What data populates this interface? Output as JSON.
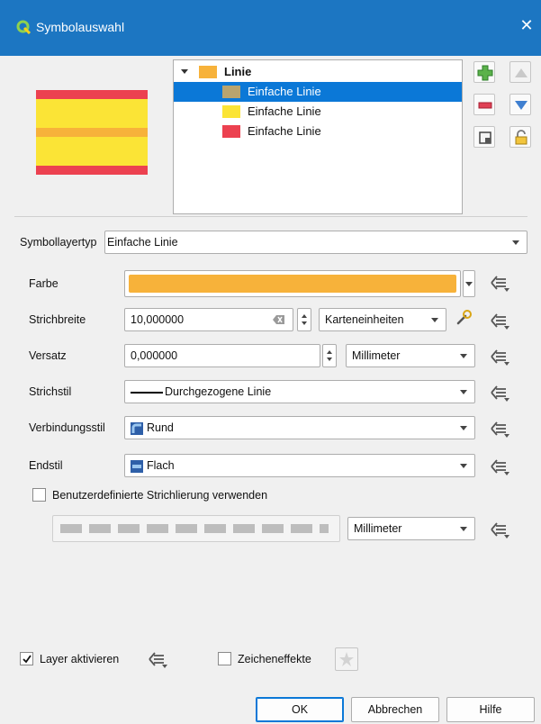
{
  "window": {
    "title": "Symbolauswahl",
    "close_glyph": "✕"
  },
  "colors": {
    "titlebar": "#1c76c2",
    "selection": "#0b78d7",
    "orange": "#f7b23a",
    "yellow": "#fbe436",
    "red": "#ec4150",
    "tan": "#b9a46e"
  },
  "tree": {
    "root_label": "Linie",
    "items": [
      {
        "label": "Einfache Linie",
        "color": "#b9a46e",
        "selected": true
      },
      {
        "label": "Einfache Linie",
        "color": "#fbe436",
        "selected": false
      },
      {
        "label": "Einfache Linie",
        "color": "#ec4150",
        "selected": false
      }
    ]
  },
  "tool_icons": [
    "add-layer-icon",
    "move-up-icon",
    "remove-layer-icon",
    "move-down-icon",
    "duplicate-layer-icon",
    "lock-icon"
  ],
  "form": {
    "symbol_layer_type_label": "Symbollayertyp",
    "symbol_layer_type_value": "Einfache Linie",
    "color_label": "Farbe",
    "stroke_width_label": "Strichbreite",
    "stroke_width_value": "10,000000",
    "stroke_width_unit": "Karteneinheiten",
    "offset_label": "Versatz",
    "offset_value": "0,000000",
    "offset_unit": "Millimeter",
    "stroke_style_label": "Strichstil",
    "stroke_style_value": "Durchgezogene Linie",
    "join_style_label": "Verbindungsstil",
    "join_style_value": "Rund",
    "cap_style_label": "Endstil",
    "cap_style_value": "Flach",
    "custom_dash_label": "Benutzerdefinierte Strichlierung verwenden",
    "custom_dash_unit": "Millimeter"
  },
  "footer": {
    "enable_layer_label": "Layer aktivieren",
    "enable_layer_checked": true,
    "draw_effects_label": "Zeicheneffekte",
    "ok_label": "OK",
    "cancel_label": "Abbrechen",
    "help_label": "Hilfe"
  }
}
